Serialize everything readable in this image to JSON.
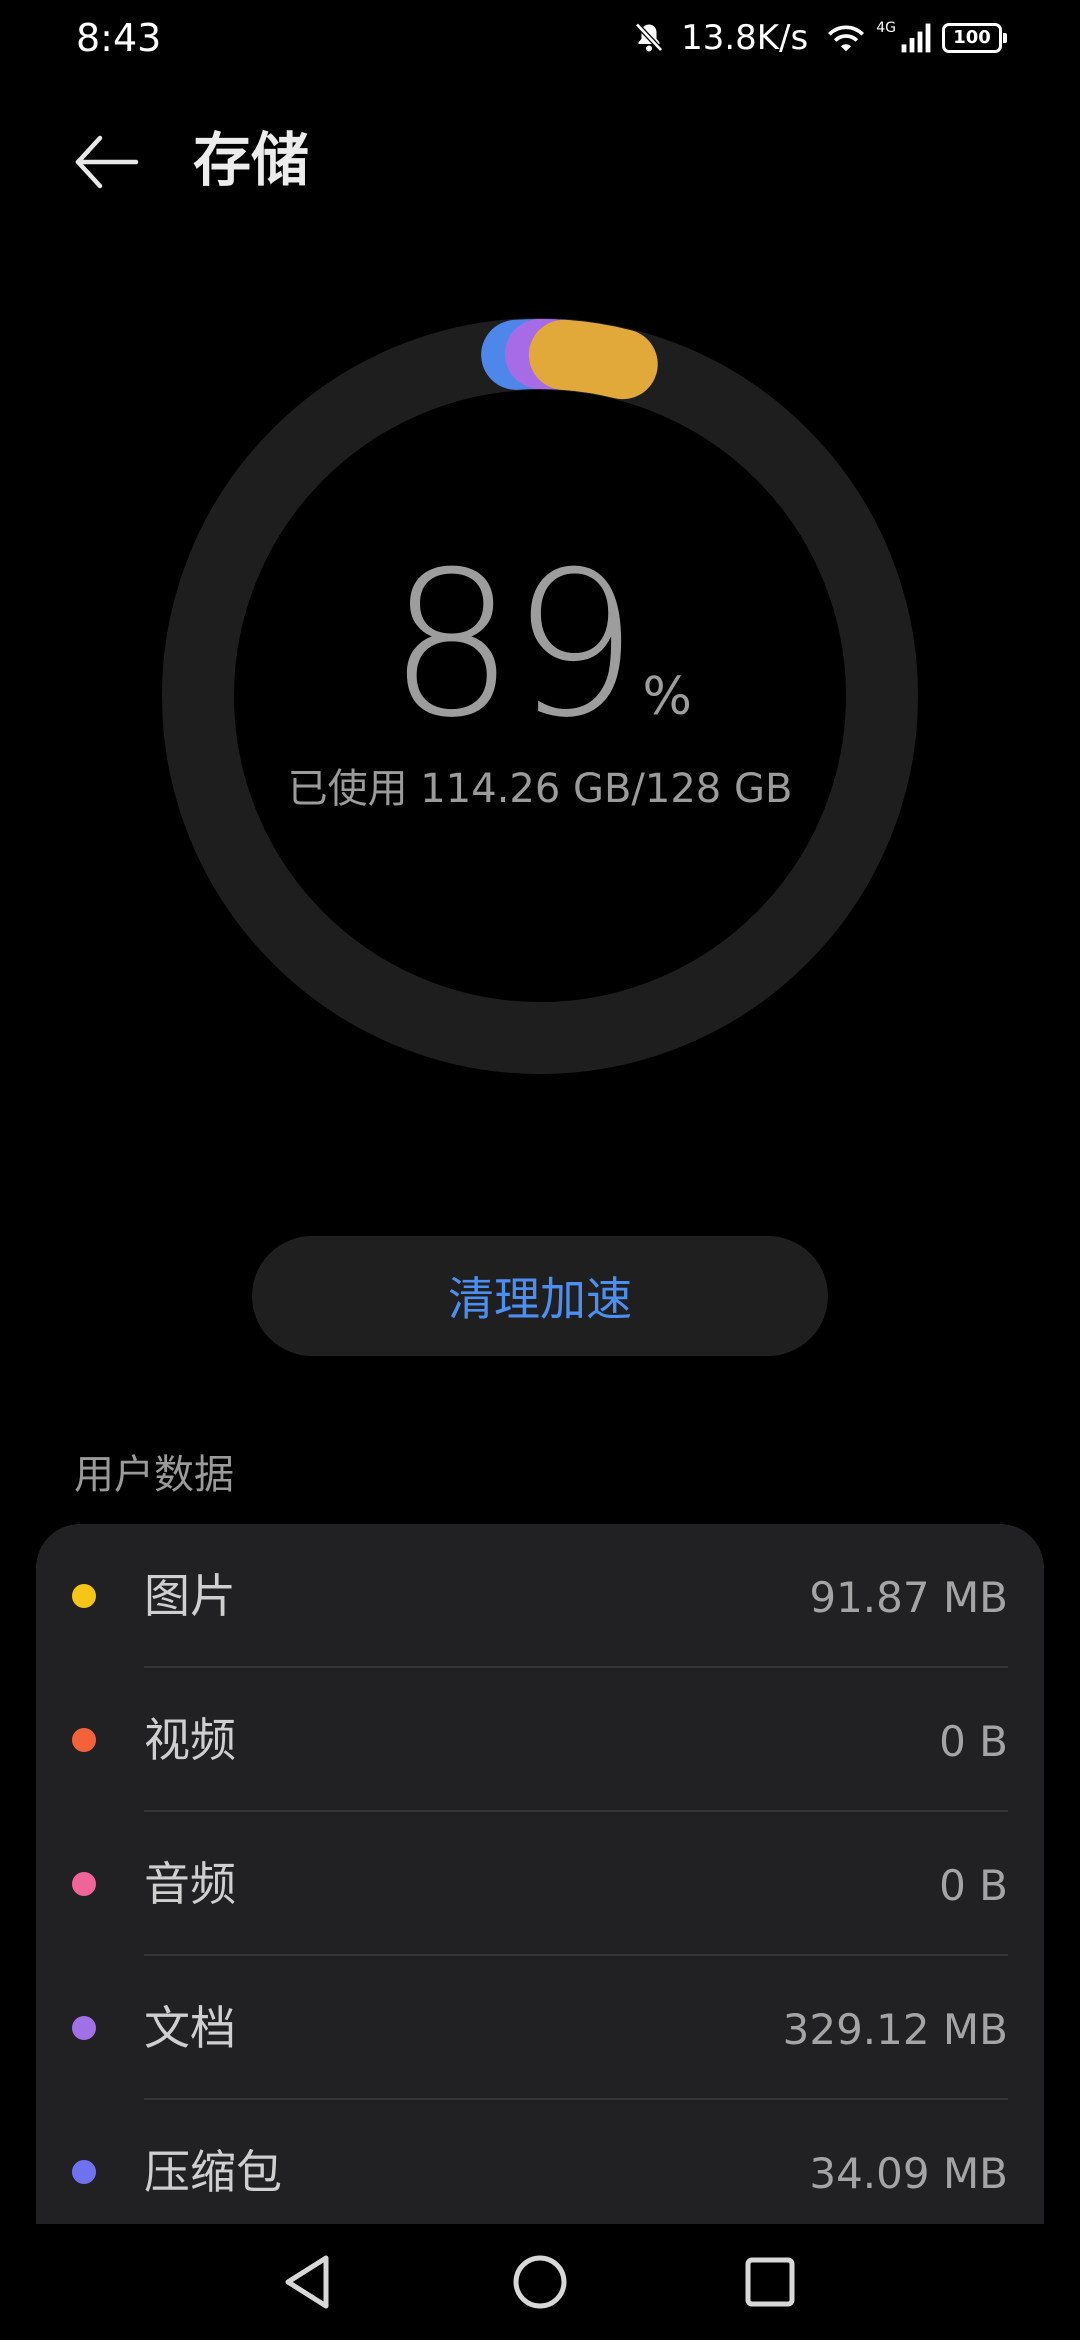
{
  "status_bar": {
    "time": "8:43",
    "net_speed": "13.8K/s",
    "network_type": "4G",
    "battery": "100",
    "icons": [
      "mute-bell-icon",
      "wifi-icon",
      "cellular-signal-icon",
      "battery-icon"
    ]
  },
  "header": {
    "title": "存储",
    "back_icon": "back-arrow-icon"
  },
  "storage": {
    "percent": "89",
    "percent_sign": "%",
    "used_text": "已使用 114.26 GB/128 GB",
    "used_fraction": 0.89,
    "ring_segments": [
      {
        "name": "图片",
        "color": "#e0a93a"
      },
      {
        "name": "文档",
        "color": "#a86be8"
      },
      {
        "name": "压缩包",
        "color": "#4f86ea"
      }
    ],
    "colors": {
      "track": "#1e1e1f"
    }
  },
  "clean_button": {
    "label": "清理加速",
    "color": "#4d8ff0"
  },
  "user_data": {
    "section_title": "用户数据",
    "items": [
      {
        "label": "图片",
        "value": "91.87 MB",
        "dot_color": "#f5c518"
      },
      {
        "label": "视频",
        "value": "0 B",
        "dot_color": "#f4623a"
      },
      {
        "label": "音频",
        "value": "0 B",
        "dot_color": "#f0649a"
      },
      {
        "label": "文档",
        "value": "329.12 MB",
        "dot_color": "#a070e6"
      },
      {
        "label": "压缩包",
        "value": "34.09 MB",
        "dot_color": "#6f72f0"
      }
    ]
  },
  "nav_bar": {
    "buttons": [
      "back-triangle-icon",
      "home-circle-icon",
      "recents-square-icon"
    ]
  }
}
